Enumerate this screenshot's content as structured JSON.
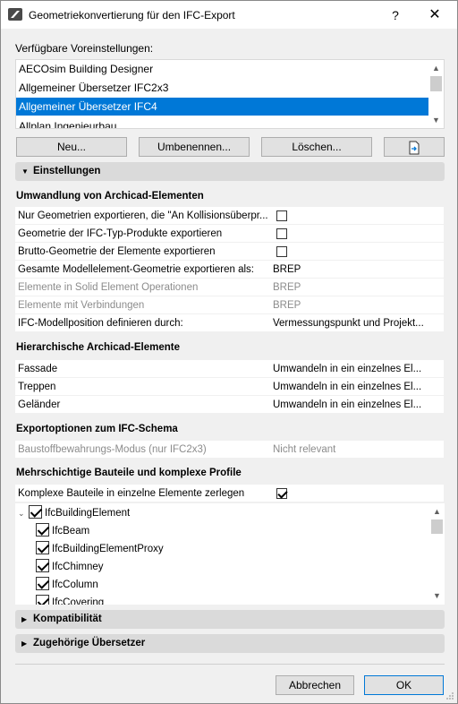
{
  "window": {
    "title": "Geometriekonvertierung für den IFC-Export",
    "help_glyph": "?",
    "close_glyph": "✕"
  },
  "presets": {
    "label": "Verfügbare Voreinstellungen:",
    "items": [
      {
        "label": "AECOsim Building Designer"
      },
      {
        "label": "Allgemeiner Übersetzer IFC2x3"
      },
      {
        "label": "Allgemeiner Übersetzer IFC4",
        "selected": true
      },
      {
        "label": "Allplan Ingenieurbau"
      }
    ],
    "buttons": {
      "new": "Neu...",
      "rename": "Umbenennen...",
      "delete": "Löschen...",
      "import_icon": "document-import-icon"
    }
  },
  "settings": {
    "header": "Einstellungen",
    "groups": {
      "conversion": {
        "title": "Umwandlung von Archicad-Elementen",
        "rows": [
          {
            "label": "Nur Geometrien exportieren, die \"An Kollisionsüberpr...",
            "checked": false
          },
          {
            "label": "Geometrie der IFC-Typ-Produkte exportieren",
            "checked": false
          },
          {
            "label": "Brutto-Geometrie der Elemente exportieren",
            "checked": false
          },
          {
            "label": "Gesamte Modellelement-Geometrie exportieren als:",
            "value": "BREP"
          },
          {
            "label": "Elemente in Solid Element Operationen",
            "value": "BREP",
            "disabled": true
          },
          {
            "label": "Elemente mit Verbindungen",
            "value": "BREP",
            "disabled": true
          },
          {
            "label": "IFC-Modellposition definieren durch:",
            "value": "Vermessungspunkt und Projekt..."
          }
        ]
      },
      "hierarchical": {
        "title": "Hierarchische Archicad-Elemente",
        "rows": [
          {
            "label": "Fassade",
            "value": "Umwandeln in ein einzelnes El..."
          },
          {
            "label": "Treppen",
            "value": "Umwandeln in ein einzelnes El..."
          },
          {
            "label": "Geländer",
            "value": "Umwandeln in ein einzelnes El..."
          }
        ]
      },
      "schema": {
        "title": "Exportoptionen zum IFC-Schema",
        "rows": [
          {
            "label": "Baustoffbewahrungs-Modus (nur IFC2x3)",
            "value": "Nicht relevant",
            "disabled": true
          }
        ]
      },
      "multilayer": {
        "title": "Mehrschichtige Bauteile und komplexe Profile",
        "rows": [
          {
            "label": "Komplexe Bauteile in einzelne Elemente zerlegen",
            "checked": true
          }
        ],
        "tree": [
          {
            "label": "IfcBuildingElement",
            "checked": true,
            "level": 0
          },
          {
            "label": "IfcBeam",
            "checked": true,
            "level": 1
          },
          {
            "label": "IfcBuildingElementProxy",
            "checked": true,
            "level": 1
          },
          {
            "label": "IfcChimney",
            "checked": true,
            "level": 1
          },
          {
            "label": "IfcColumn",
            "checked": true,
            "level": 1
          },
          {
            "label": "IfcCovering",
            "checked": true,
            "level": 1
          }
        ]
      }
    }
  },
  "sections": {
    "compat": "Kompatibilität",
    "translators": "Zugehörige Übersetzer"
  },
  "footer": {
    "cancel": "Abbrechen",
    "ok": "OK"
  },
  "colors": {
    "accent": "#0078d7",
    "section_bar": "#dadada",
    "background": "#f0f0f0"
  }
}
